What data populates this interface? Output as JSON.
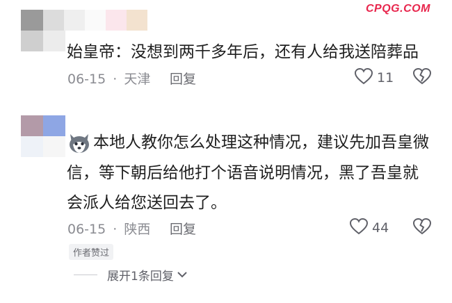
{
  "watermark": "CPQG.COM",
  "comments": [
    {
      "text": "始皇帝：没想到两千多年后，还有人给我送陪葬品",
      "date": "06-15",
      "location": "天津",
      "reply_label": "回复",
      "likes": "11"
    },
    {
      "text_line1": "本地人教你怎么处理这种情况，建议先加吾皇微",
      "text_line2": "信，等下朝后给他打个语音说明情况，黑了吾皇就",
      "text_line3": "会派人给您送回去了。",
      "date": "06-15",
      "location": "陕西",
      "reply_label": "回复",
      "likes": "44",
      "author_tag": "作者赞过",
      "expand_label": "展开1条回复"
    }
  ],
  "separator": "·",
  "colors": {
    "watermark": "#e8264d",
    "text": "#1f1f1f",
    "meta": "#8a8b91"
  },
  "icons": {
    "like": "heart-outline-icon",
    "dislike": "broken-heart-icon",
    "expand": "chevron-down-icon",
    "emoji": "husky-dog-emoji-icon"
  }
}
